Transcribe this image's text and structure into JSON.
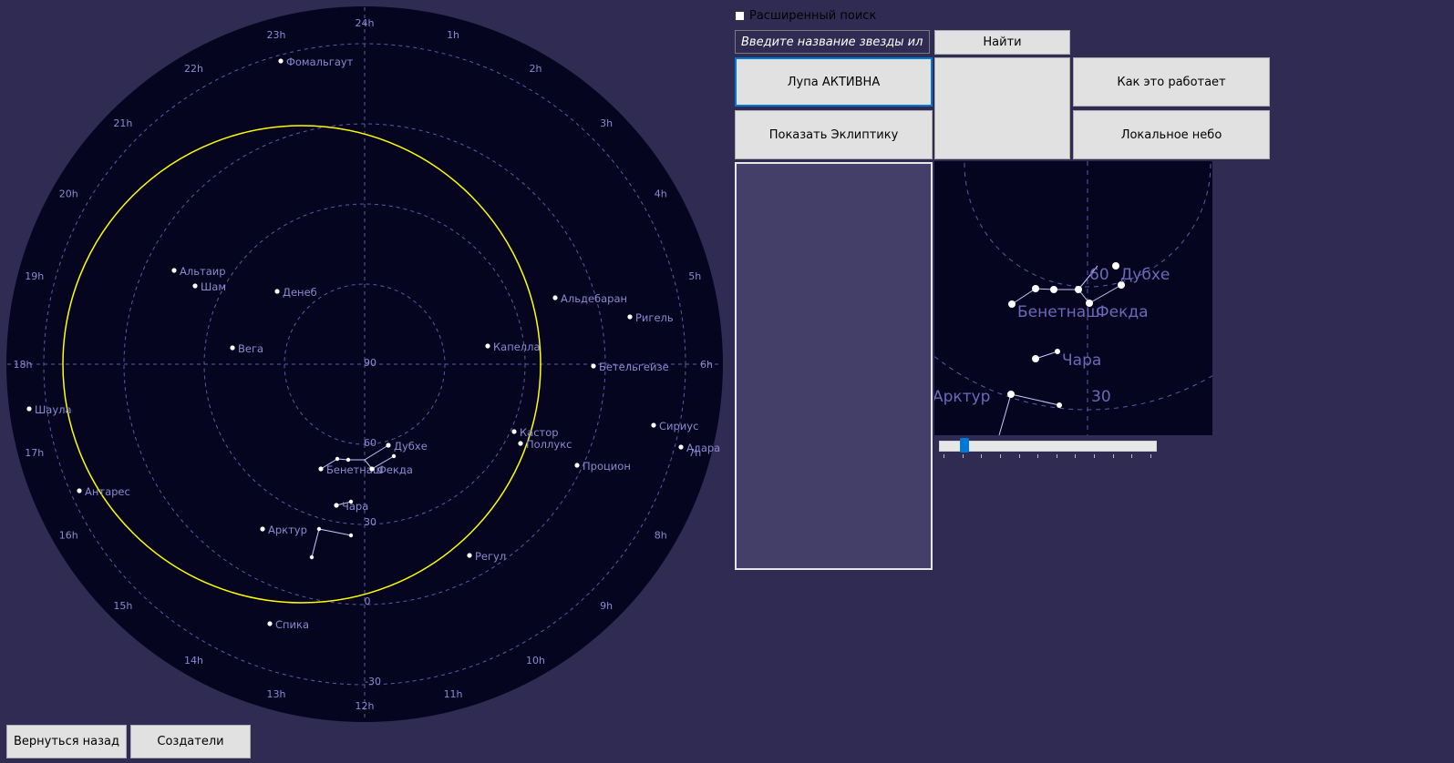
{
  "advanced_search": {
    "label": "Расширенный поиск",
    "checked": false
  },
  "search": {
    "placeholder": "Введите название звезды или созвездия",
    "find_label": "Найти"
  },
  "buttons": {
    "magnifier": "Лупа АКТИВНА",
    "ecliptic": "Показать Эклиптику",
    "how_it_works": "Как это работает",
    "local_sky": "Локальное небо",
    "back": "Вернуться назад",
    "creators": "Создатели"
  },
  "sky_map": {
    "hour_labels": [
      "24h",
      "1h",
      "2h",
      "3h",
      "4h",
      "5h",
      "6h",
      "7h",
      "8h",
      "9h",
      "10h",
      "11h",
      "12h",
      "13h",
      "14h",
      "15h",
      "16h",
      "17h",
      "18h",
      "19h",
      "20h",
      "21h",
      "22h",
      "23h"
    ],
    "dec_labels": [
      "90",
      "60",
      "30",
      "0",
      "-30"
    ],
    "stars": [
      {
        "name": "Фомальгаут",
        "label": "Фомальгаут"
      },
      {
        "name": "Альтаир",
        "label": "Альтаир"
      },
      {
        "name": "Шам",
        "label": "Шам"
      },
      {
        "name": "Денеб",
        "label": "Денеб"
      },
      {
        "name": "Вега",
        "label": "Вега"
      },
      {
        "name": "Шаула",
        "label": "Шаула"
      },
      {
        "name": "Антарес",
        "label": "Антарес"
      },
      {
        "name": "Арктур",
        "label": "Арктур"
      },
      {
        "name": "Спика",
        "label": "Спика"
      },
      {
        "name": "Альдебаран",
        "label": "Альдебаран"
      },
      {
        "name": "Ригель",
        "label": "Ригель"
      },
      {
        "name": "Капелла",
        "label": "Капелла"
      },
      {
        "name": "Бетельгейзе",
        "label": "Бетельгейзе"
      },
      {
        "name": "Сириус",
        "label": "Сириус"
      },
      {
        "name": "Адара",
        "label": "Адара"
      },
      {
        "name": "Кастор",
        "label": "Кастор"
      },
      {
        "name": "Поллукс",
        "label": "Поллукс"
      },
      {
        "name": "Процион",
        "label": "Процион"
      },
      {
        "name": "Регул",
        "label": "Регул"
      },
      {
        "name": "Дубхе",
        "label": "Дубхе"
      },
      {
        "name": "Бенетнаш",
        "label": "Бенетнаш"
      },
      {
        "name": "Фекда",
        "label": "Фекда"
      },
      {
        "name": "Чара",
        "label": "Чара"
      }
    ]
  },
  "zoom_view": {
    "labels": [
      "60",
      "Дубхе",
      "Бенетнаш",
      "Фекда",
      "Чара",
      "Арктур",
      "30"
    ]
  },
  "zoom_slider": {
    "value": 0.1,
    "ticks": 12
  },
  "colors": {
    "background": "#302b52",
    "sky": "#06051f",
    "grid": "#5a5aa8",
    "labels": "#8a8ad0",
    "ecliptic": "#ffff00",
    "accent": "#0078d7"
  }
}
